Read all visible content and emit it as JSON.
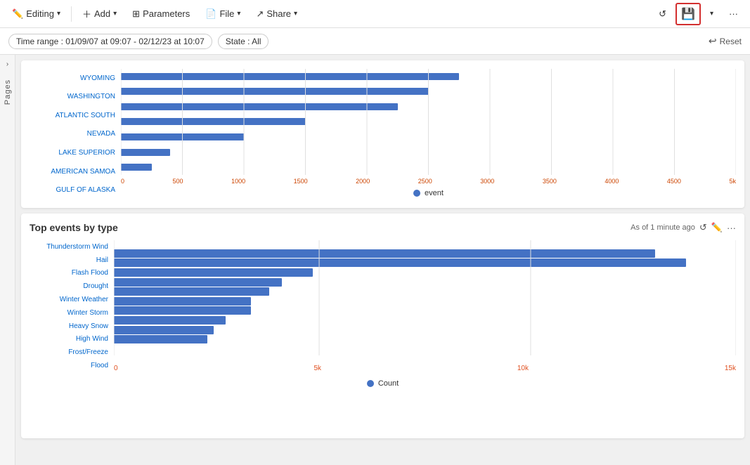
{
  "toolbar": {
    "editing_label": "Editing",
    "add_label": "Add",
    "parameters_label": "Parameters",
    "file_label": "File",
    "share_label": "Share",
    "chevron": "›"
  },
  "filter_bar": {
    "time_range_label": "Time range : 01/09/07 at 09:07 - 02/12/23 at 10:07",
    "state_label": "State : All",
    "reset_label": "Reset"
  },
  "pages_sidebar": {
    "label": "Pages",
    "chevron": "›"
  },
  "top_chart": {
    "legend_label": "event",
    "y_labels": [
      "WYOMING",
      "WASHINGTON",
      "ATLANTIC SOUTH",
      "NEVADA",
      "LAKE SUPERIOR",
      "AMERICAN SAMOA",
      "GULF OF ALASKA"
    ],
    "x_labels": [
      "0",
      "500",
      "1000",
      "1500",
      "2000",
      "2500",
      "3000",
      "3500",
      "4000",
      "4500",
      "5k"
    ],
    "bars": [
      55,
      50,
      45,
      30,
      20,
      8,
      5
    ]
  },
  "bottom_chart": {
    "title": "Top events by type",
    "meta": "As of 1 minute ago",
    "legend_label": "Count",
    "y_labels": [
      "Thunderstorm Wind",
      "Hail",
      "Flash Flood",
      "Drought",
      "Winter Weather",
      "Winter Storm",
      "Heavy Snow",
      "High Wind",
      "Frost/Freeze",
      "Flood"
    ],
    "x_labels": [
      "0",
      "5k",
      "10k",
      "15k"
    ],
    "bars_percent": [
      87,
      92,
      32,
      27,
      25,
      22,
      22,
      18,
      16,
      15
    ]
  }
}
